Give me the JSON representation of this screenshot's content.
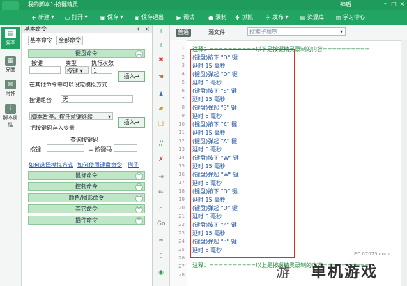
{
  "title_bar": {
    "title": "我的脚本1-按键精灵",
    "user": "神盾",
    "min": "–",
    "max": "□",
    "close": "×"
  },
  "toolbar": {
    "new": "新建",
    "open": "打开",
    "save": "保存",
    "save_exit": "保存退出",
    "debug": "调试",
    "record": "录制",
    "capture": "抓抓",
    "publish": "发布",
    "resources": "资源库",
    "learn": "学习中心"
  },
  "left_nav": {
    "script": "脚本",
    "ui": "界面",
    "attach": "附件",
    "props": "脚本属性"
  },
  "panel": {
    "header": "基本命令",
    "pin": "♯",
    "close": "×",
    "tab_basic": "基本命令",
    "tab_all": "全部命令",
    "keyboard_section": "键盘命令",
    "col_key": "按键",
    "col_type": "类型",
    "col_count": "执行次数",
    "type_value": "按键",
    "count_value": "1",
    "insert": "插入→",
    "combo_hint": "在其他命令中可以设定模拟方式",
    "combo_label": "按键组合",
    "combo_value": "无",
    "pause_select": "脚本暂停，按任意键继续",
    "save_key_label": "把按键码存入变量",
    "query_title": "查询按键码",
    "query_key": "按键",
    "query_code": "= 按键码",
    "link_sim": "如何选择模拟方式",
    "link_use": "如何使用键盘命令",
    "link_example": "例子",
    "sec_mouse": "鼠标命令",
    "sec_control": "控制命令",
    "sec_color": "颜色/图形命令",
    "sec_other": "其它命令",
    "sec_plugin": "插件命令"
  },
  "editor": {
    "tab_normal": "普通",
    "tab_source": "源文件",
    "search_placeholder": "搜索子程序",
    "lines": [
      "注释：==========以下是按键精灵录制的内容==========",
      "(键盘)按下 \"D\" 键",
      "延时 15 毫秒",
      "(键盘)弹起 \"D\" 键",
      "延时 5 毫秒",
      "(键盘)按下 \"S\" 键",
      "延时 15 毫秒",
      "(键盘)弹起 \"S\" 键",
      "延时 5 毫秒",
      "(键盘)按下 \"A\" 键",
      "延时 15 毫秒",
      "(键盘)弹起 \"A\" 键",
      "延时 5 毫秒",
      "(键盘)按下 \"W\" 键",
      "延时 15 毫秒",
      "(键盘)弹起 \"W\" 键",
      "延时 5 毫秒",
      "(键盘)按下 \"D\" 键",
      "延时 15 毫秒",
      "(键盘)弹起 \"D\" 键",
      "延时 5 毫秒",
      "(键盘)按下 \"h\" 键",
      "延时 15 毫秒",
      "(键盘)弹起 \"h\" 键",
      "延时 5 毫秒",
      "注释：==========以上是按键精灵录制的内容=========="
    ],
    "line_numbers": [
      "1",
      "2",
      "3",
      "4",
      "5",
      "6",
      "7",
      "8",
      "9",
      "10",
      "11",
      "12",
      "13",
      "14",
      "15",
      "16",
      "17",
      "18",
      "19",
      "20",
      "21",
      "22",
      "23",
      "24",
      "25",
      "26",
      "27",
      "28"
    ]
  },
  "watermark": {
    "text": "单机游戏",
    "url": "PC.07073.com",
    "glyph": "游"
  }
}
